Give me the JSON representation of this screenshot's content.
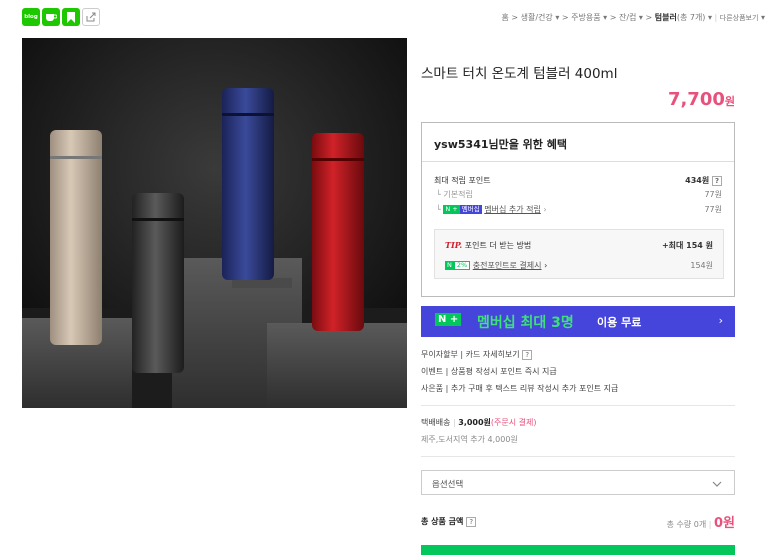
{
  "topbar": {
    "blog_icon_text": "blog",
    "breadcrumb": {
      "home": "홈",
      "sep": ">",
      "cat1": "생활/건강",
      "cat2": "주방용품",
      "cat3": "잔/컵",
      "cat4": "텀블러",
      "count": "(총 7개)",
      "other": "다른상품보기"
    }
  },
  "product": {
    "title": "스마트 터치 온도계 텀블러 400ml",
    "price": "7,700",
    "price_unit": "원"
  },
  "benefit": {
    "title": "ysw5341님만을 위한 혜택",
    "max_points_label": "최대 적립 포인트",
    "max_points_value": "434원",
    "basic_label": "기본적립",
    "basic_value": "77원",
    "membership_badge": "멤버십",
    "membership_label": "멤버십 추가 적립",
    "membership_value": "77원",
    "tip_prefix": "TIP.",
    "tip_label": "포인트 더 받는 방법",
    "tip_max": "+최대 154 원",
    "charge_badge": "2%",
    "charge_label": "충전포인트로 결제시",
    "charge_value": "154원",
    "help": "?"
  },
  "banner": {
    "plus": "N +",
    "text": "멤버십 최대 3명",
    "suffix": "이용 무료"
  },
  "info": {
    "line1": "무이자할부 | 카드 자세히보기",
    "line2": "이벤트 | 상품평 작성시 포인트 즉시 지급",
    "line3": "사은품 | 추가 구매 후 텍스트 리뷰 작성시 추가 포인트 지급"
  },
  "shipping": {
    "label": "택배배송",
    "price": "3,000원",
    "note": "(주문시 결제)",
    "extra": "제주,도서지역 추가 4,000원"
  },
  "options": {
    "selected": "옵션선택"
  },
  "total": {
    "label": "총 상품 금액",
    "qty": "총 수량 0개",
    "amount": "0원"
  },
  "colors": {
    "price": "#e8517c",
    "naver_green": "#03c75a",
    "banner": "#4545dc"
  }
}
